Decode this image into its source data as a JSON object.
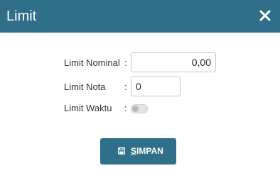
{
  "dialog": {
    "title": "Limit",
    "close_icon": "close-icon"
  },
  "form": {
    "limit_nominal": {
      "label": "Limit Nominal",
      "colon": ":",
      "value": "0,00"
    },
    "limit_nota": {
      "label": "Limit Nota",
      "colon": ":",
      "value": "0"
    },
    "limit_waktu": {
      "label": "Limit Waktu",
      "colon": ":",
      "enabled": false
    }
  },
  "actions": {
    "save": {
      "first_letter": "S",
      "rest": "IMPAN",
      "icon": "floppy-disk-icon"
    }
  },
  "colors": {
    "primary": "#2f6f8a",
    "text": "#333333"
  }
}
